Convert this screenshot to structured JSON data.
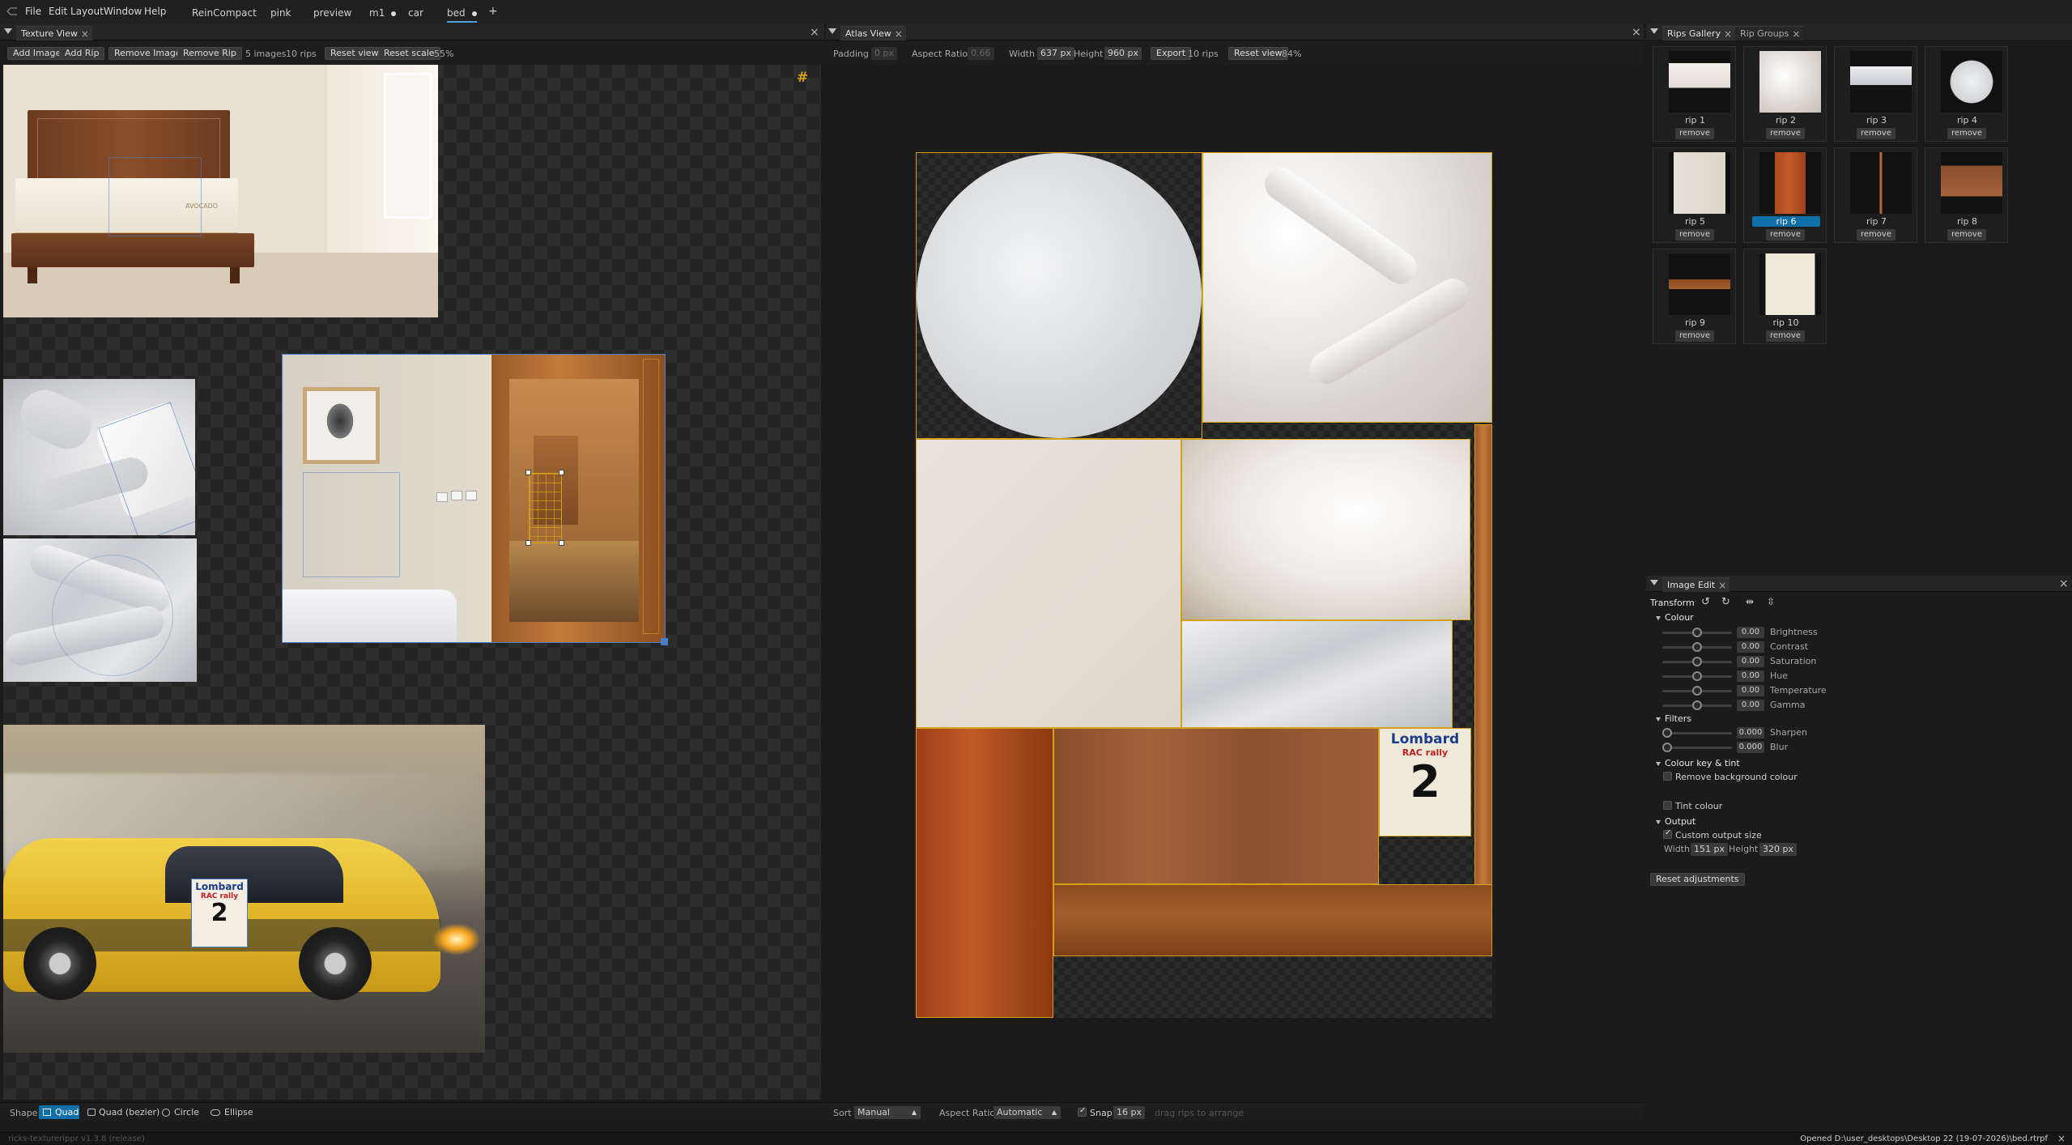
{
  "app": {
    "title": "ricks-texturerippr"
  },
  "menu": {
    "items": [
      "File",
      "Edit",
      "Layout",
      "Window",
      "Help"
    ]
  },
  "documents": [
    {
      "label": "ReinCompact",
      "modified": false
    },
    {
      "label": "pink",
      "modified": false
    },
    {
      "label": "preview",
      "modified": false
    },
    {
      "label": "m1",
      "modified": true
    },
    {
      "label": "car",
      "modified": false
    },
    {
      "label": "bed",
      "modified": true,
      "active": true
    }
  ],
  "add_tab_label": "+",
  "texture_view": {
    "tab_label": "Texture View",
    "add_image": "Add Image",
    "add_rip": "Add Rip",
    "remove_image": "Remove Image",
    "remove_rip": "Remove Rip",
    "image_count": "5 images",
    "rip_count": "10 rips",
    "reset_view": "Reset view",
    "reset_scale": "Reset scale",
    "zoom": "55%",
    "grid_icon": "#",
    "shape_label": "Shape",
    "shapes": [
      {
        "label": "Quad",
        "selected": true
      },
      {
        "label": "Quad (bezier)",
        "selected": false
      },
      {
        "label": "Circle",
        "selected": false
      },
      {
        "label": "Ellipse",
        "selected": false
      }
    ]
  },
  "atlas_view": {
    "tab_label": "Atlas View",
    "padding_label": "Padding",
    "padding_value": "0 px",
    "aspect_label": "Aspect Ratio",
    "aspect_value": "0.66",
    "width_label": "Width",
    "width_value": "637 px",
    "height_label": "Height",
    "height_value": "960 px",
    "export": "Export",
    "rip_count": "10 rips",
    "reset_view": "Reset view",
    "zoom": "84%",
    "sort_label": "Sort",
    "sort_value": "Manual",
    "bottom_aspect_label": "Aspect Ratio",
    "bottom_aspect_value": "Automatic",
    "snap_label": "Snap",
    "snap_value": "16 px",
    "hint": "drag rips to arrange",
    "tile_stamp": {
      "line1": "Lombard",
      "line2": "RAC rally",
      "line3": "2"
    }
  },
  "rips_gallery": {
    "tab_label": "Rips Gallery",
    "groups_tab_label": "Rip Groups",
    "remove_label": "remove",
    "items": [
      {
        "name": "rip 1",
        "selected": false
      },
      {
        "name": "rip 2",
        "selected": false
      },
      {
        "name": "rip 3",
        "selected": false
      },
      {
        "name": "rip 4",
        "selected": false
      },
      {
        "name": "rip 5",
        "selected": false
      },
      {
        "name": "rip 6",
        "selected": true
      },
      {
        "name": "rip 7",
        "selected": false
      },
      {
        "name": "rip 8",
        "selected": false
      },
      {
        "name": "rip 9",
        "selected": false
      },
      {
        "name": "rip 10",
        "selected": false
      }
    ]
  },
  "image_edit": {
    "tab_label": "Image Edit",
    "transform_label": "Transform",
    "colour_section": "Colour",
    "colour_sliders": [
      {
        "label": "Brightness",
        "value": "0.00",
        "pos": 0.5
      },
      {
        "label": "Contrast",
        "value": "0.00",
        "pos": 0.5
      },
      {
        "label": "Saturation",
        "value": "0.00",
        "pos": 0.5
      },
      {
        "label": "Hue",
        "value": "0.00",
        "pos": 0.5
      },
      {
        "label": "Temperature",
        "value": "0.00",
        "pos": 0.5
      },
      {
        "label": "Gamma",
        "value": "0.00",
        "pos": 0.5
      }
    ],
    "filters_section": "Filters",
    "filter_sliders": [
      {
        "label": "Sharpen",
        "value": "0.000",
        "pos": 0
      },
      {
        "label": "Blur",
        "value": "0.000",
        "pos": 0
      }
    ],
    "key_section": "Colour key & tint",
    "remove_bg": "Remove background colour",
    "tint_colour": "Tint colour",
    "output_section": "Output",
    "custom_size": "Custom output size",
    "width_label": "Width",
    "width_value": "151 px",
    "height_label": "Height",
    "height_value": "320 px",
    "reset_adjustments": "Reset adjustments"
  },
  "status": {
    "left": "ricks-texturerippr v1.3.8 (release)",
    "right": "Opened D:\\user_desktops\\Desktop 22 (19-07-2026)\\bed.rtrpf"
  },
  "car_decal": {
    "line1": "Lombard",
    "line2": "RAC rally",
    "line3": "2"
  },
  "bed_brand": "AVOCADO",
  "colors": {
    "accent": "#d4a017",
    "selection": "#0f6fa8",
    "outline": "#4b7fc2"
  }
}
